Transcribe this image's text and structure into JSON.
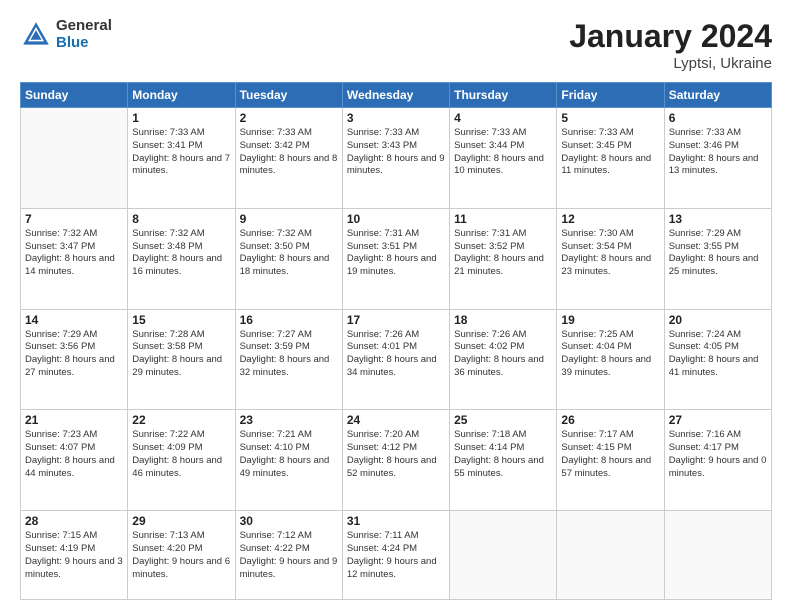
{
  "logo": {
    "general": "General",
    "blue": "Blue"
  },
  "title": "January 2024",
  "subtitle": "Lyptsi, Ukraine",
  "days": [
    "Sunday",
    "Monday",
    "Tuesday",
    "Wednesday",
    "Thursday",
    "Friday",
    "Saturday"
  ],
  "weeks": [
    [
      {
        "day": "",
        "sunrise": "",
        "sunset": "",
        "daylight": ""
      },
      {
        "day": "1",
        "sunrise": "Sunrise: 7:33 AM",
        "sunset": "Sunset: 3:41 PM",
        "daylight": "Daylight: 8 hours and 7 minutes."
      },
      {
        "day": "2",
        "sunrise": "Sunrise: 7:33 AM",
        "sunset": "Sunset: 3:42 PM",
        "daylight": "Daylight: 8 hours and 8 minutes."
      },
      {
        "day": "3",
        "sunrise": "Sunrise: 7:33 AM",
        "sunset": "Sunset: 3:43 PM",
        "daylight": "Daylight: 8 hours and 9 minutes."
      },
      {
        "day": "4",
        "sunrise": "Sunrise: 7:33 AM",
        "sunset": "Sunset: 3:44 PM",
        "daylight": "Daylight: 8 hours and 10 minutes."
      },
      {
        "day": "5",
        "sunrise": "Sunrise: 7:33 AM",
        "sunset": "Sunset: 3:45 PM",
        "daylight": "Daylight: 8 hours and 11 minutes."
      },
      {
        "day": "6",
        "sunrise": "Sunrise: 7:33 AM",
        "sunset": "Sunset: 3:46 PM",
        "daylight": "Daylight: 8 hours and 13 minutes."
      }
    ],
    [
      {
        "day": "7",
        "sunrise": "Sunrise: 7:32 AM",
        "sunset": "Sunset: 3:47 PM",
        "daylight": "Daylight: 8 hours and 14 minutes."
      },
      {
        "day": "8",
        "sunrise": "Sunrise: 7:32 AM",
        "sunset": "Sunset: 3:48 PM",
        "daylight": "Daylight: 8 hours and 16 minutes."
      },
      {
        "day": "9",
        "sunrise": "Sunrise: 7:32 AM",
        "sunset": "Sunset: 3:50 PM",
        "daylight": "Daylight: 8 hours and 18 minutes."
      },
      {
        "day": "10",
        "sunrise": "Sunrise: 7:31 AM",
        "sunset": "Sunset: 3:51 PM",
        "daylight": "Daylight: 8 hours and 19 minutes."
      },
      {
        "day": "11",
        "sunrise": "Sunrise: 7:31 AM",
        "sunset": "Sunset: 3:52 PM",
        "daylight": "Daylight: 8 hours and 21 minutes."
      },
      {
        "day": "12",
        "sunrise": "Sunrise: 7:30 AM",
        "sunset": "Sunset: 3:54 PM",
        "daylight": "Daylight: 8 hours and 23 minutes."
      },
      {
        "day": "13",
        "sunrise": "Sunrise: 7:29 AM",
        "sunset": "Sunset: 3:55 PM",
        "daylight": "Daylight: 8 hours and 25 minutes."
      }
    ],
    [
      {
        "day": "14",
        "sunrise": "Sunrise: 7:29 AM",
        "sunset": "Sunset: 3:56 PM",
        "daylight": "Daylight: 8 hours and 27 minutes."
      },
      {
        "day": "15",
        "sunrise": "Sunrise: 7:28 AM",
        "sunset": "Sunset: 3:58 PM",
        "daylight": "Daylight: 8 hours and 29 minutes."
      },
      {
        "day": "16",
        "sunrise": "Sunrise: 7:27 AM",
        "sunset": "Sunset: 3:59 PM",
        "daylight": "Daylight: 8 hours and 32 minutes."
      },
      {
        "day": "17",
        "sunrise": "Sunrise: 7:26 AM",
        "sunset": "Sunset: 4:01 PM",
        "daylight": "Daylight: 8 hours and 34 minutes."
      },
      {
        "day": "18",
        "sunrise": "Sunrise: 7:26 AM",
        "sunset": "Sunset: 4:02 PM",
        "daylight": "Daylight: 8 hours and 36 minutes."
      },
      {
        "day": "19",
        "sunrise": "Sunrise: 7:25 AM",
        "sunset": "Sunset: 4:04 PM",
        "daylight": "Daylight: 8 hours and 39 minutes."
      },
      {
        "day": "20",
        "sunrise": "Sunrise: 7:24 AM",
        "sunset": "Sunset: 4:05 PM",
        "daylight": "Daylight: 8 hours and 41 minutes."
      }
    ],
    [
      {
        "day": "21",
        "sunrise": "Sunrise: 7:23 AM",
        "sunset": "Sunset: 4:07 PM",
        "daylight": "Daylight: 8 hours and 44 minutes."
      },
      {
        "day": "22",
        "sunrise": "Sunrise: 7:22 AM",
        "sunset": "Sunset: 4:09 PM",
        "daylight": "Daylight: 8 hours and 46 minutes."
      },
      {
        "day": "23",
        "sunrise": "Sunrise: 7:21 AM",
        "sunset": "Sunset: 4:10 PM",
        "daylight": "Daylight: 8 hours and 49 minutes."
      },
      {
        "day": "24",
        "sunrise": "Sunrise: 7:20 AM",
        "sunset": "Sunset: 4:12 PM",
        "daylight": "Daylight: 8 hours and 52 minutes."
      },
      {
        "day": "25",
        "sunrise": "Sunrise: 7:18 AM",
        "sunset": "Sunset: 4:14 PM",
        "daylight": "Daylight: 8 hours and 55 minutes."
      },
      {
        "day": "26",
        "sunrise": "Sunrise: 7:17 AM",
        "sunset": "Sunset: 4:15 PM",
        "daylight": "Daylight: 8 hours and 57 minutes."
      },
      {
        "day": "27",
        "sunrise": "Sunrise: 7:16 AM",
        "sunset": "Sunset: 4:17 PM",
        "daylight": "Daylight: 9 hours and 0 minutes."
      }
    ],
    [
      {
        "day": "28",
        "sunrise": "Sunrise: 7:15 AM",
        "sunset": "Sunset: 4:19 PM",
        "daylight": "Daylight: 9 hours and 3 minutes."
      },
      {
        "day": "29",
        "sunrise": "Sunrise: 7:13 AM",
        "sunset": "Sunset: 4:20 PM",
        "daylight": "Daylight: 9 hours and 6 minutes."
      },
      {
        "day": "30",
        "sunrise": "Sunrise: 7:12 AM",
        "sunset": "Sunset: 4:22 PM",
        "daylight": "Daylight: 9 hours and 9 minutes."
      },
      {
        "day": "31",
        "sunrise": "Sunrise: 7:11 AM",
        "sunset": "Sunset: 4:24 PM",
        "daylight": "Daylight: 9 hours and 12 minutes."
      },
      {
        "day": "",
        "sunrise": "",
        "sunset": "",
        "daylight": ""
      },
      {
        "day": "",
        "sunrise": "",
        "sunset": "",
        "daylight": ""
      },
      {
        "day": "",
        "sunrise": "",
        "sunset": "",
        "daylight": ""
      }
    ]
  ]
}
